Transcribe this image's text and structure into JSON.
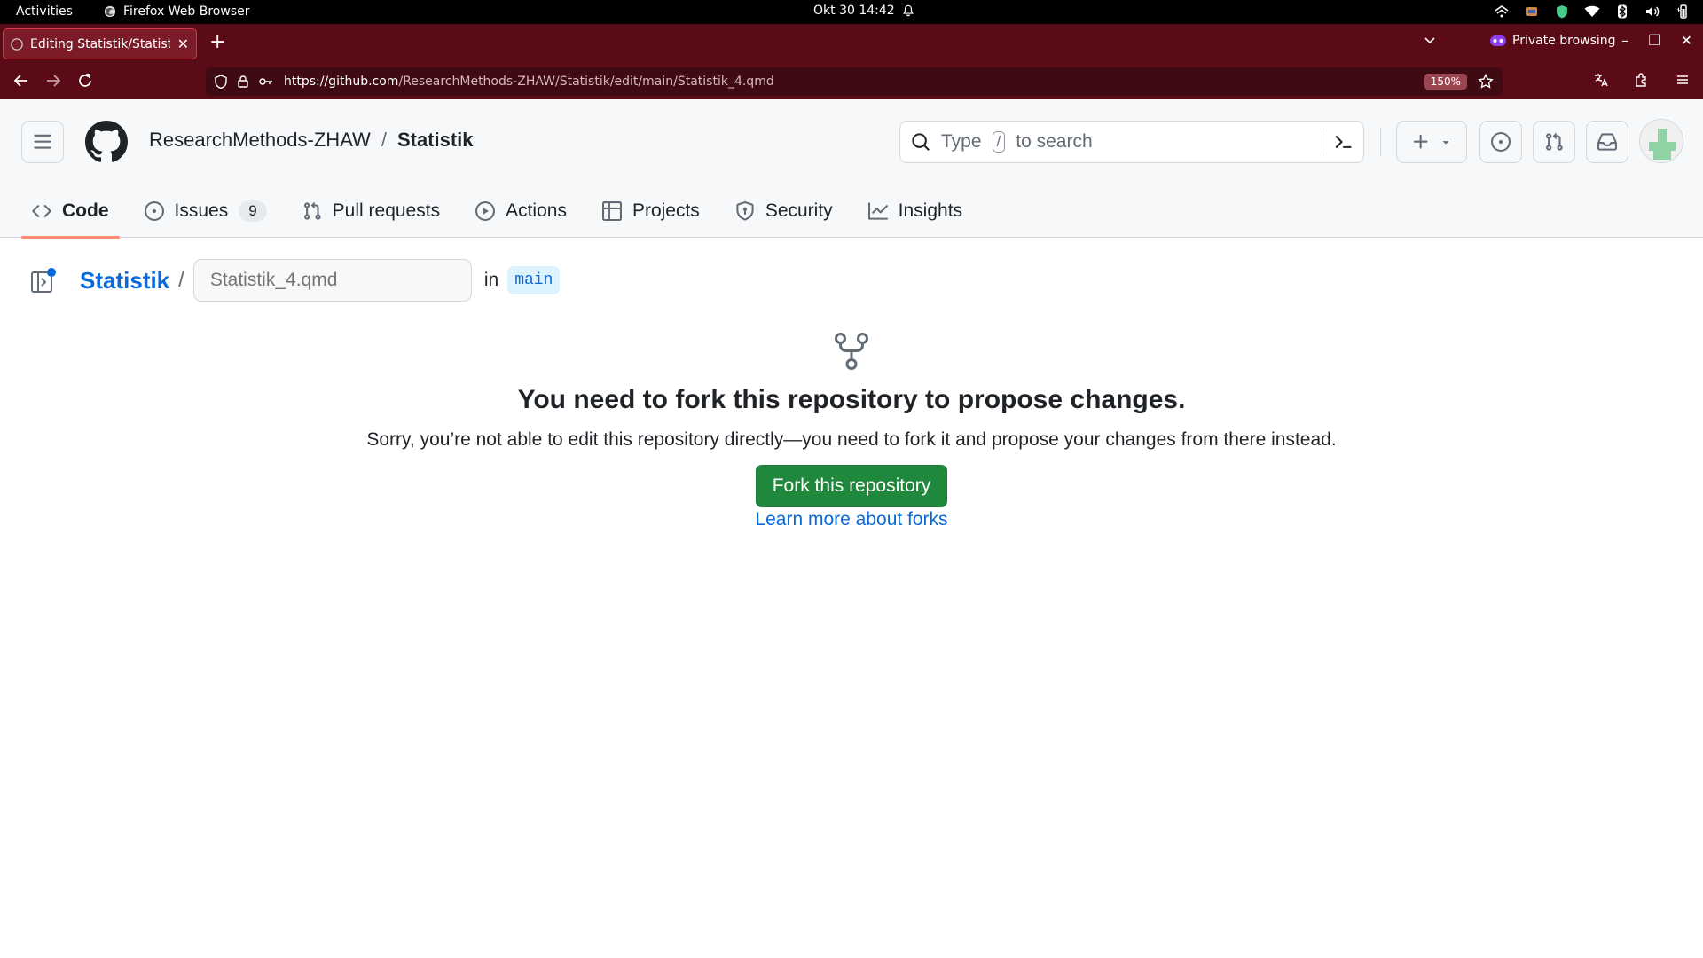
{
  "system_bar": {
    "activities": "Activities",
    "app_name": "Firefox Web Browser",
    "clock": "Okt 30  14:42"
  },
  "browser": {
    "tab_title": "Editing Statistik/Statistik_4.qmd",
    "private_label": "Private browsing",
    "url_host": "https://github.com",
    "url_path": "/ResearchMethods-ZHAW/Statistik/edit/main/Statistik_4.qmd",
    "zoom": "150%",
    "accent_color": "#5b0b15"
  },
  "github": {
    "owner": "ResearchMethods-ZHAW",
    "separator": "/",
    "repo": "Statistik",
    "search_placeholder_prefix": "Type",
    "search_key": "/",
    "search_placeholder_suffix": "to search",
    "tabs": [
      {
        "label": "Code",
        "icon": "code-icon",
        "selected": true
      },
      {
        "label": "Issues",
        "icon": "issue-opened-icon",
        "counter": "9"
      },
      {
        "label": "Pull requests",
        "icon": "git-pull-request-icon"
      },
      {
        "label": "Actions",
        "icon": "play-icon"
      },
      {
        "label": "Projects",
        "icon": "table-icon"
      },
      {
        "label": "Security",
        "icon": "shield-icon"
      },
      {
        "label": "Insights",
        "icon": "graph-icon"
      }
    ]
  },
  "editor": {
    "repo_link": "Statistik",
    "path_separator": "/",
    "filename_placeholder": "Statistik_4.qmd",
    "in_label": "in",
    "branch": "main"
  },
  "blankslate": {
    "icon": "repo-forked-icon",
    "title": "You need to fork this repository to propose changes.",
    "description": "Sorry, you’re not able to edit this repository directly—you need to fork it and propose your changes from there instead.",
    "button": "Fork this repository",
    "link": "Learn more about forks",
    "button_color": "#1f883d",
    "link_color": "#0969da"
  }
}
